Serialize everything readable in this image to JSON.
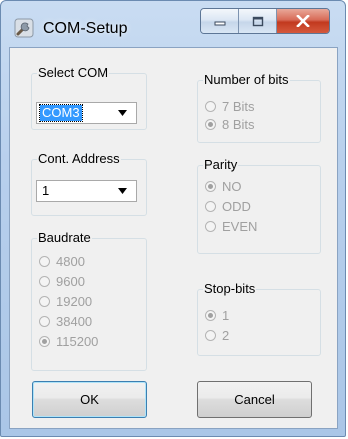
{
  "window": {
    "title": "COM-Setup"
  },
  "title_buttons": [
    {
      "name": "minimize",
      "icon": "minimize-icon"
    },
    {
      "name": "maximize",
      "icon": "maximize-icon"
    },
    {
      "name": "close",
      "icon": "close-icon"
    }
  ],
  "select_com": {
    "label": "Select COM",
    "value": "COM3"
  },
  "cont_address": {
    "label": "Cont. Address",
    "value": "1"
  },
  "baudrate": {
    "label": "Baudrate",
    "options": [
      "4800",
      "9600",
      "19200",
      "38400",
      "115200"
    ],
    "selected": "115200"
  },
  "number_of_bits": {
    "label": "Number of bits",
    "options": [
      "7 Bits",
      "8 Bits"
    ],
    "selected": "8 Bits"
  },
  "parity": {
    "label": "Parity",
    "options": [
      "NO",
      "ODD",
      "EVEN"
    ],
    "selected": "NO"
  },
  "stop_bits": {
    "label": "Stop-bits",
    "options": [
      "1",
      "2"
    ],
    "selected": "1"
  },
  "buttons": {
    "ok": "OK",
    "cancel": "Cancel"
  },
  "colors": {
    "frame": "#b7cfec",
    "client": "#f0f0f0",
    "close_button": "#c2391f",
    "selection": "#3399ff",
    "disabled_text": "#a0a0a0"
  }
}
